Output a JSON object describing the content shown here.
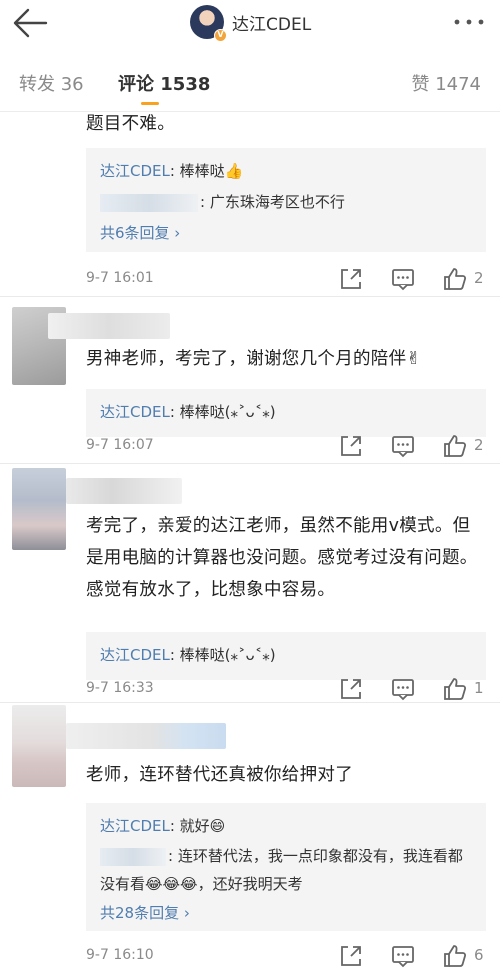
{
  "header": {
    "title": "达江CDEL",
    "badge": "V"
  },
  "tabs": {
    "repost": "转发 36",
    "comment": "评论 1538",
    "like": "赞 1474"
  },
  "comments": [
    {
      "content_tail": "题目不难。",
      "replies": [
        {
          "author": "达江CDEL",
          "text": ": 棒棒哒👍"
        },
        {
          "author": "",
          "text": ": 广东珠海考区也不行"
        }
      ],
      "more": "共6条回复 ›",
      "time": "9-7 16:01",
      "likes": "2"
    },
    {
      "content": "男神老师，考完了，谢谢您几个月的陪伴✌",
      "replies": [
        {
          "author": "达江CDEL",
          "text": ": 棒棒哒(⁎˃ᴗ˂⁎)"
        }
      ],
      "time": "9-7 16:07",
      "likes": "2"
    },
    {
      "content": "考完了，亲爱的达江老师，虽然不能用v模式。但是用电脑的计算器也没问题。感觉考过没有问题。感觉有放水了，比想象中容易。",
      "replies": [
        {
          "author": "达江CDEL",
          "text": ": 棒棒哒(⁎˃ᴗ˂⁎)"
        }
      ],
      "time": "9-7 16:33",
      "likes": "1"
    },
    {
      "content": "老师，连环替代还真被你给押对了",
      "replies": [
        {
          "author": "达江CDEL",
          "text": ": 就好😄"
        },
        {
          "author": "",
          "text": ": 连环替代法，我一点印象都没有，我连看都没有看😂😂😂，还好我明天考"
        }
      ],
      "more": "共28条回复 ›",
      "time": "9-7 16:10",
      "likes": "6"
    }
  ],
  "colors": {
    "accent": "#f8a21f",
    "link": "#507daf",
    "reply_bg": "#f4f4f4"
  }
}
